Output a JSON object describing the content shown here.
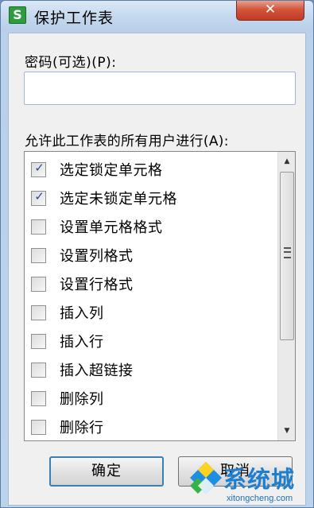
{
  "window": {
    "title": "保护工作表",
    "app_icon_letter": "S",
    "close_glyph": "✕"
  },
  "password": {
    "label": "密码(可选)(P):",
    "value": ""
  },
  "permissions": {
    "label": "允许此工作表的所有用户进行(A):",
    "items": [
      {
        "label": "选定锁定单元格",
        "checked": true
      },
      {
        "label": "选定未锁定单元格",
        "checked": true
      },
      {
        "label": "设置单元格格式",
        "checked": false
      },
      {
        "label": "设置列格式",
        "checked": false
      },
      {
        "label": "设置行格式",
        "checked": false
      },
      {
        "label": "插入列",
        "checked": false
      },
      {
        "label": "插入行",
        "checked": false
      },
      {
        "label": "插入超链接",
        "checked": false
      },
      {
        "label": "删除列",
        "checked": false
      },
      {
        "label": "删除行",
        "checked": false
      }
    ],
    "check_glyph": "✓"
  },
  "scrollbar": {
    "up_glyph": "▲",
    "down_glyph": "▼"
  },
  "buttons": {
    "ok": "确定",
    "cancel": "取消"
  },
  "watermark": {
    "brand": "系统城",
    "url": "xitongcheng.com"
  },
  "colors": {
    "accent": "#3c7fb1",
    "close": "#c23a22",
    "watermark": "#1e7fcf"
  }
}
